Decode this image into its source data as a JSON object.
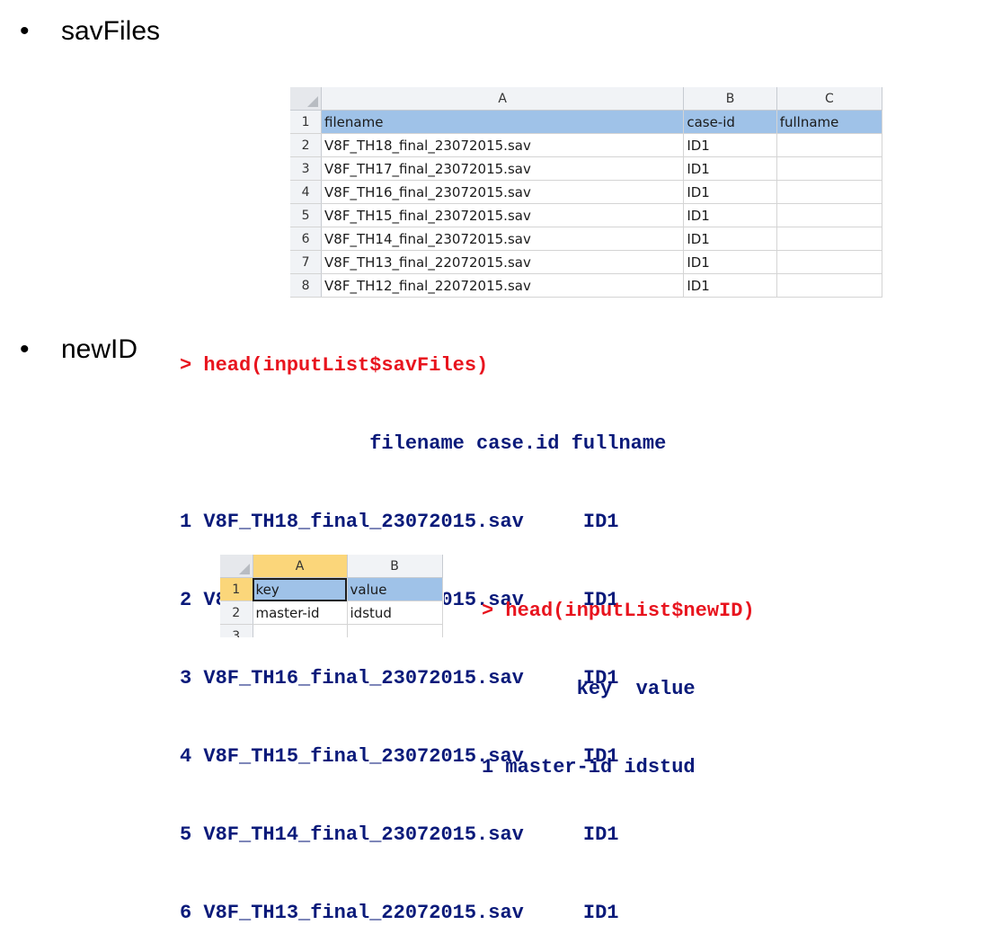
{
  "bullets": [
    {
      "symbol": "•",
      "text": "savFiles"
    },
    {
      "symbol": "•",
      "text": "newID"
    }
  ],
  "sheet1": {
    "col_headers": [
      "A",
      "B",
      "C"
    ],
    "rows": [
      {
        "num": "1",
        "cells": [
          "filename",
          "case-id",
          "fullname"
        ]
      },
      {
        "num": "2",
        "cells": [
          "V8F_TH18_final_23072015.sav",
          "ID1",
          ""
        ]
      },
      {
        "num": "3",
        "cells": [
          "V8F_TH17_final_23072015.sav",
          "ID1",
          ""
        ]
      },
      {
        "num": "4",
        "cells": [
          "V8F_TH16_final_23072015.sav",
          "ID1",
          ""
        ]
      },
      {
        "num": "5",
        "cells": [
          "V8F_TH15_final_23072015.sav",
          "ID1",
          ""
        ]
      },
      {
        "num": "6",
        "cells": [
          "V8F_TH14_final_23072015.sav",
          "ID1",
          ""
        ]
      },
      {
        "num": "7",
        "cells": [
          "V8F_TH13_final_22072015.sav",
          "ID1",
          ""
        ]
      },
      {
        "num": "8",
        "cells": [
          "V8F_TH12_final_22072015.sav",
          "ID1",
          ""
        ]
      }
    ]
  },
  "console1": {
    "command": "> head(inputList$savFiles)",
    "header": "                filename case.id fullname",
    "rows": [
      "1 V8F_TH18_final_23072015.sav     ID1",
      "2 V8F_TH17_final_23072015.sav     ID1",
      "3 V8F_TH16_final_23072015.sav     ID1",
      "4 V8F_TH15_final_23072015.sav     ID1",
      "5 V8F_TH14_final_23072015.sav     ID1",
      "6 V8F_TH13_final_22072015.sav     ID1"
    ]
  },
  "sheet2": {
    "col_headers": [
      "A",
      "B"
    ],
    "rows": [
      {
        "num": "1",
        "cells": [
          "key",
          "value"
        ]
      },
      {
        "num": "2",
        "cells": [
          "master-id",
          "idstud"
        ]
      },
      {
        "num": "3",
        "cells": [
          "",
          ""
        ]
      }
    ]
  },
  "console2": {
    "command": "> head(inputList$newID)",
    "header": "        key  value",
    "rows": [
      "1 master-id idstud"
    ]
  }
}
